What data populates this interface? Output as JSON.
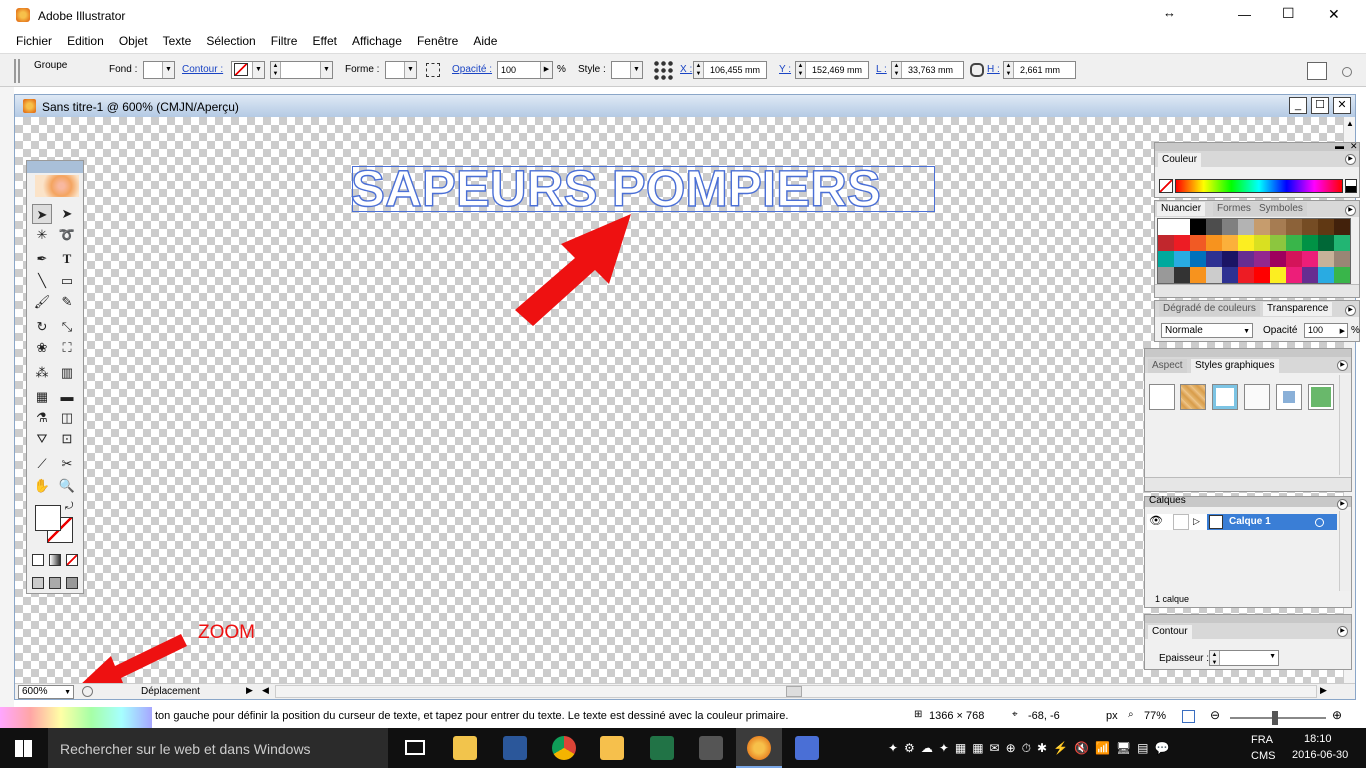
{
  "window": {
    "title": "Adobe Illustrator",
    "min": "—",
    "max": "☐",
    "close": "✕",
    "resize": "↔"
  },
  "menu": [
    "Fichier",
    "Edition",
    "Objet",
    "Texte",
    "Sélection",
    "Filtre",
    "Effet",
    "Affichage",
    "Fenêtre",
    "Aide"
  ],
  "controlbar": {
    "object_type": "Groupe",
    "fill_label": "Fond :",
    "stroke_label": "Contour :",
    "shape_label": "Forme :",
    "opacity_label": "Opacité :",
    "opacity_value": "100",
    "percent": "%",
    "style_label": "Style :",
    "x_label": "X :",
    "x_value": "106,455 mm",
    "y_label": "Y :",
    "y_value": "152,469 mm",
    "w_label": "L :",
    "w_value": "33,763 mm",
    "h_label": "H :",
    "h_value": "2,661 mm"
  },
  "document": {
    "title": "Sans titre-1 @ 600% (CMJN/Aperçu)",
    "artwork_text": "SAPEURS POMPIERS",
    "zoom": "600%",
    "status_tool": "Déplacement"
  },
  "annotations": {
    "zoom_label": "ZOOM",
    "arrow_color": "#ee1111"
  },
  "panels": {
    "color": {
      "tab": "Couleur"
    },
    "swatches": {
      "tabs": [
        "Nuancier",
        "Formes",
        "Symboles"
      ]
    },
    "gradient": {
      "tabs": [
        "Dégradé de couleurs",
        "Transparence"
      ],
      "blend_mode": "Normale",
      "opacity_label": "Opacité",
      "opacity_value": "100",
      "percent": "%"
    },
    "graphic_styles": {
      "tabs": [
        "Aspect",
        "Styles graphiques"
      ]
    },
    "layers": {
      "tab": "Calques",
      "layer_name": "Calque 1",
      "footer": "1 calque"
    },
    "stroke": {
      "tab": "Contour",
      "weight_label": "Epaisseur :"
    }
  },
  "statusbar": {
    "hint": "ton gauche pour définir la position du curseur de texte, et tapez pour entrer du texte. Le texte est dessiné avec la couleur primaire.",
    "dimensions": "1366 × 768",
    "coords": "-68, -6",
    "unit": "px",
    "zoom": "77%"
  },
  "taskbar": {
    "search_placeholder": "Rechercher sur le web et dans Windows",
    "lang": "FRA",
    "layout": "CMS",
    "time": "18:10",
    "date": "2016-06-30"
  }
}
